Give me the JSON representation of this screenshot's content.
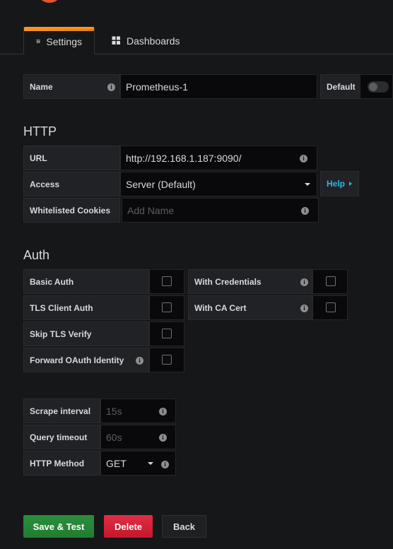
{
  "tabs": [
    {
      "label": "Settings",
      "icon": "sliders-icon",
      "active": true
    },
    {
      "label": "Dashboards",
      "icon": "grid-icon",
      "active": false
    }
  ],
  "general": {
    "name_label": "Name",
    "name_value": "Prometheus-1",
    "default_label": "Default",
    "default_on": false
  },
  "http": {
    "title": "HTTP",
    "url_label": "URL",
    "url_value": "http://192.168.1.187:9090/",
    "access_label": "Access",
    "access_value": "Server (Default)",
    "help_label": "Help",
    "cookies_label": "Whitelisted Cookies",
    "cookies_placeholder": "Add Name"
  },
  "auth": {
    "title": "Auth",
    "basic_auth": "Basic Auth",
    "with_credentials": "With Credentials",
    "tls_client_auth": "TLS Client Auth",
    "with_ca_cert": "With CA Cert",
    "skip_tls_verify": "Skip TLS Verify",
    "forward_oauth": "Forward OAuth Identity"
  },
  "misc": {
    "scrape_label": "Scrape interval",
    "scrape_placeholder": "15s",
    "query_label": "Query timeout",
    "query_placeholder": "60s",
    "method_label": "HTTP Method",
    "method_value": "GET"
  },
  "buttons": {
    "save": "Save & Test",
    "delete": "Delete",
    "back": "Back"
  },
  "colors": {
    "accent": "#f79520",
    "save": "#299c46",
    "delete": "#e02f44",
    "link": "#33b5e5"
  }
}
